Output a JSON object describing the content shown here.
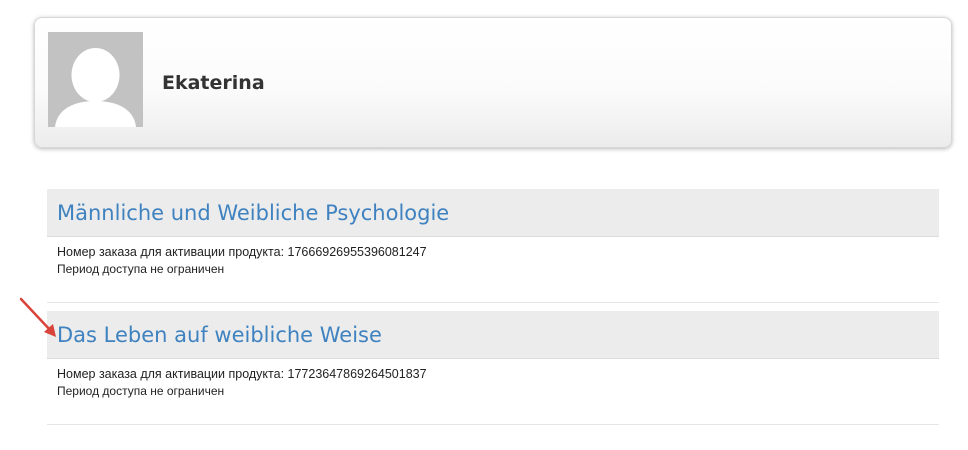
{
  "profile": {
    "name": "Ekaterina",
    "avatar_icon": "default-user-avatar-icon"
  },
  "products": [
    {
      "title": "Männliche und Weibliche Psychologie",
      "order_text": "Номер заказа для активации продукта: 17666926955396081247",
      "access_text": "Период доступа не ограничен"
    },
    {
      "title": "Das Leben auf weibliche Weise",
      "order_text": "Номер заказа для активации продукта: 17723647869264501837",
      "access_text": "Период доступа не ограничен"
    }
  ],
  "colors": {
    "link": "#3f82c0",
    "header_bg": "#ececec",
    "arrow": "#d9433a",
    "avatar_bg": "#c2c2c2"
  }
}
